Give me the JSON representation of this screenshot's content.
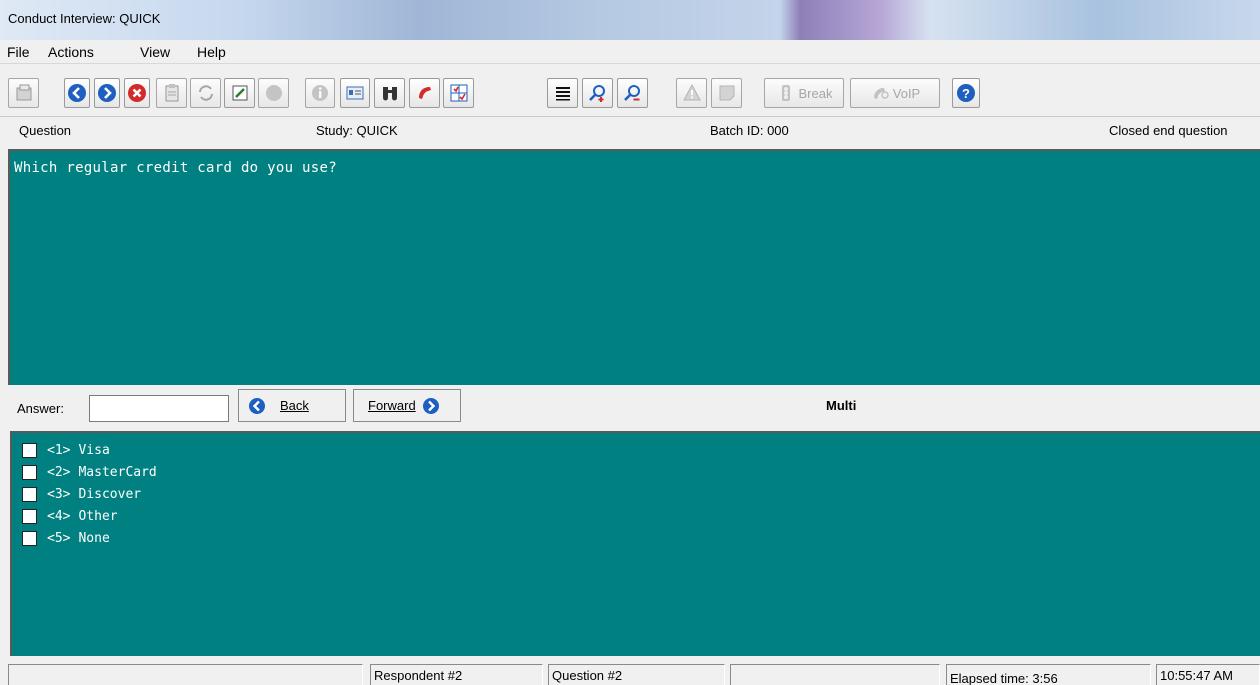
{
  "window": {
    "title": "Conduct Interview: QUICK"
  },
  "menu": [
    "File",
    "Actions",
    "View",
    "Help"
  ],
  "toolbar": {
    "buttons": [
      {
        "name": "open-icon"
      },
      {
        "name": "back-arrow-icon"
      },
      {
        "name": "forward-arrow-icon"
      },
      {
        "name": "stop-icon"
      },
      {
        "name": "clipboard-icon"
      },
      {
        "name": "refresh-icon"
      },
      {
        "name": "edit-icon"
      },
      {
        "name": "circle-icon"
      },
      {
        "name": "info-icon"
      },
      {
        "name": "id-card-icon"
      },
      {
        "name": "binoculars-icon"
      },
      {
        "name": "phone-icon"
      },
      {
        "name": "grid-check-icon"
      },
      {
        "name": "list-icon"
      },
      {
        "name": "zoom-in-icon"
      },
      {
        "name": "zoom-out-icon"
      },
      {
        "name": "warning-icon"
      },
      {
        "name": "note-icon"
      },
      {
        "name": "break-icon",
        "label": "Break"
      },
      {
        "name": "voip-icon",
        "label": "VoIP"
      },
      {
        "name": "help-icon"
      }
    ]
  },
  "info": {
    "question_type_label": "Question",
    "study": "Study: QUICK",
    "batch": "Batch ID: 000",
    "question_kind": "Closed end question"
  },
  "question": {
    "text": "Which regular credit card do you use?"
  },
  "answer": {
    "label": "Answer:",
    "value": "",
    "back_label": "Back",
    "forward_label": "Forward",
    "mode": "Multi"
  },
  "responses": [
    {
      "code": "<1>",
      "text": "Visa",
      "checked": false
    },
    {
      "code": "<2>",
      "text": "MasterCard",
      "checked": false
    },
    {
      "code": "<3>",
      "text": "Discover",
      "checked": false
    },
    {
      "code": "<4>",
      "text": "Other",
      "checked": false
    },
    {
      "code": "<5>",
      "text": "None",
      "checked": false
    }
  ],
  "status": {
    "cell1": "",
    "respondent": "Respondent #2",
    "question": "Question #2",
    "cell4": "",
    "elapsed": "Elapsed time: 3:56",
    "clock": "10:55:47 AM"
  },
  "colors": {
    "panel": "#008080",
    "panel_text": "#ffffff",
    "accent_blue": "#1e5fbf",
    "stop_red": "#d42a2a"
  }
}
